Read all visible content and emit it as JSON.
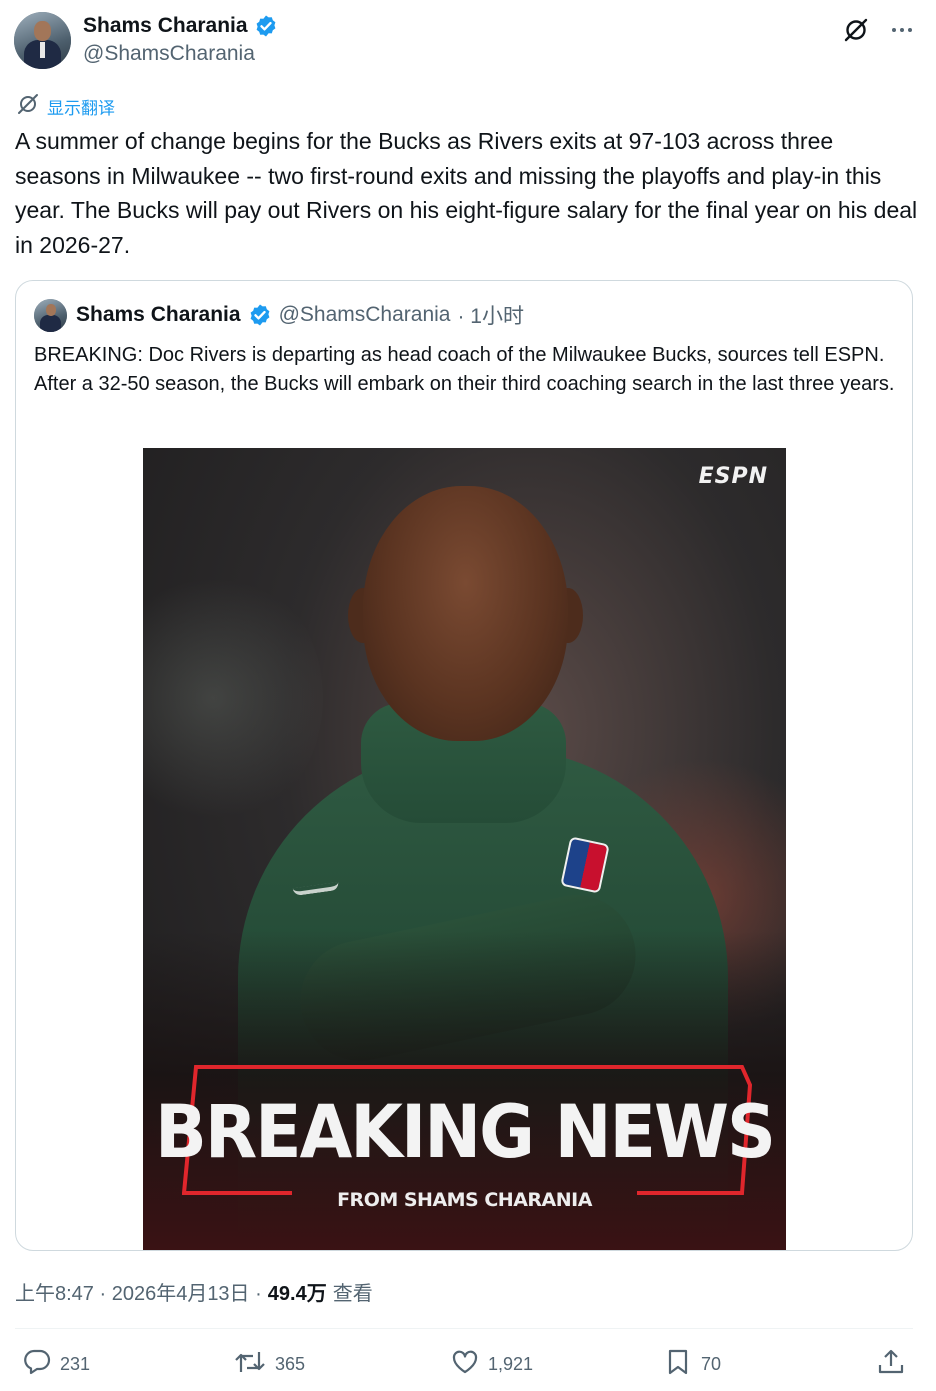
{
  "author": {
    "name": "Shams Charania",
    "handle": "@ShamsCharania"
  },
  "translate_label": "显示翻译",
  "tweet_text": "A summer of change begins for the Bucks as Rivers exits at 97-103 across three seasons in Milwaukee -- two first-round exits and missing the playoffs and play-in this year. The Bucks will pay out Rivers on his eight-figure salary for the final year on his deal in 2026-27.",
  "quoted_tweet": {
    "name": "Shams Charania",
    "handle": "@ShamsCharania",
    "time": "· 1小时",
    "text": "BREAKING: Doc Rivers is departing as head coach of the Milwaukee Bucks, sources tell ESPN. After a 32-50 season, the Bucks will embark on their third coaching search in the last three years.",
    "media": {
      "logo": "ESPN",
      "headline": "BREAKING NEWS",
      "subline": "FROM SHAMS CHARANIA",
      "accent": "#e0262c"
    }
  },
  "meta": {
    "timestamp": "上午8:47 · 2026年4月13日 ·",
    "views_count": "49.4万",
    "views_label": "查看"
  },
  "actions": {
    "replies": "231",
    "reposts": "365",
    "likes": "1,921",
    "bookmarks": "70"
  },
  "icons": [
    "grok-icon",
    "more-icon",
    "verified-badge-icon",
    "translate-icon",
    "reply-icon",
    "repost-icon",
    "like-icon",
    "bookmark-icon",
    "share-icon"
  ],
  "colors": {
    "link_blue": "#1d9bf0",
    "verified_blue": "#1d9bf0",
    "secondary_text": "#536471"
  }
}
